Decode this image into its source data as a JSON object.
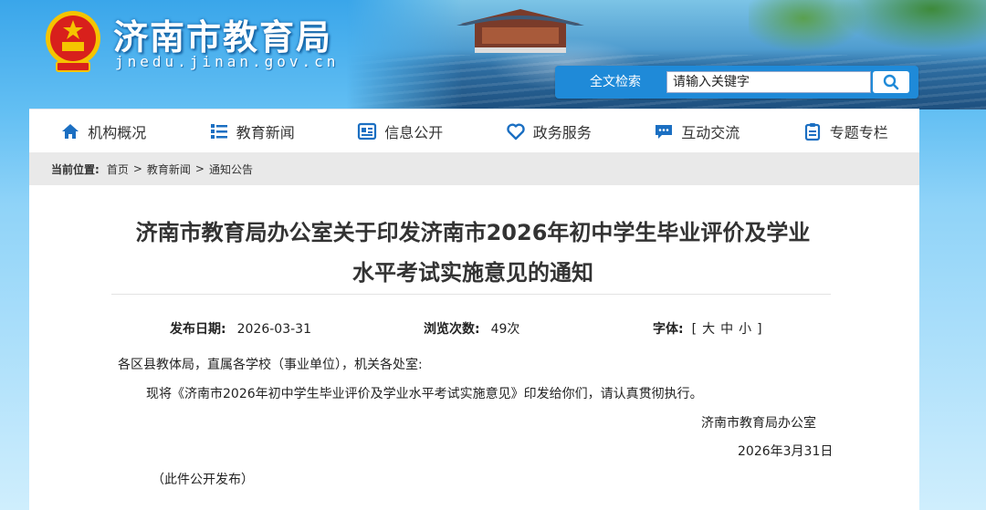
{
  "header": {
    "site_title": "济南市教育局",
    "site_domain": "jnedu.jinan.gov.cn",
    "search_label": "全文检索",
    "search_placeholder": "请输入关键字"
  },
  "nav": [
    {
      "label": "机构概况",
      "icon": "home-icon"
    },
    {
      "label": "教育新闻",
      "icon": "list-icon"
    },
    {
      "label": "信息公开",
      "icon": "newspaper-icon"
    },
    {
      "label": "政务服务",
      "icon": "heart-icon"
    },
    {
      "label": "互动交流",
      "icon": "chat-icon"
    },
    {
      "label": "专题专栏",
      "icon": "clipboard-icon"
    }
  ],
  "breadcrumb": {
    "label": "当前位置:",
    "items": [
      "首页",
      "教育新闻",
      "通知公告"
    ],
    "separator": ">"
  },
  "article": {
    "title_line1": "济南市教育局办公室关于印发济南市2026年初中学生毕业评价及学业",
    "title_line2": "水平考试实施意见的通知",
    "publish_label": "发布日期:",
    "publish_date": "2026-03-31",
    "views_label": "浏览次数:",
    "views": "49次",
    "font_label": "字体:",
    "font_open": "[",
    "font_large": "大",
    "font_medium": "中",
    "font_small": "小",
    "font_close": "]",
    "salutation": "各区县教体局，直属各学校（事业单位），机关各处室:",
    "body": "现将《济南市2026年初中学生毕业评价及学业水平考试实施意见》印发给你们，请认真贯彻执行。",
    "signature": "济南市教育局办公室",
    "sign_date": "2026年3月31日",
    "note": "（此件公开发布）"
  },
  "colors": {
    "nav_icon": "#1b6fc2",
    "search_bar": "#1f8ad8",
    "emblem_red": "#d8201c",
    "emblem_gold": "#f5c400"
  }
}
